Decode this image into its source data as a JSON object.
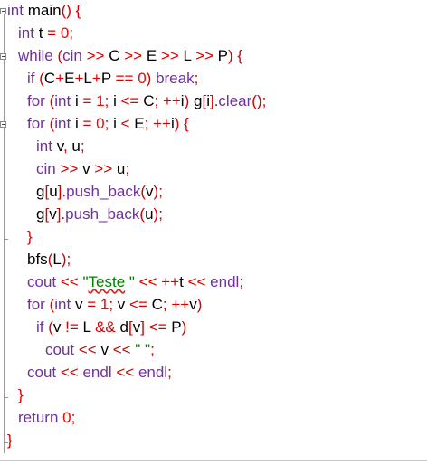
{
  "editor": {
    "lines": [
      "int main() {",
      "int t = 0;",
      "while (cin >> C >> E >> L >> P) {",
      "if (C+E+L+P == 0) break;",
      "for (int i = 1; i <= C; ++i) g[i].clear();",
      "for (int i = 0; i < E; ++i) {",
      "int v, u;",
      "cin >> v >> u;",
      "g[u].push_back(v);",
      "g[v].push_back(u);",
      "}",
      "bfs(L);",
      "cout << \"Teste \" << ++t << endl;",
      "for (int v = 1; v <= C; ++v)",
      "if (v != L && d[v] <= P)",
      "cout << v << \" \";",
      "cout << endl << endl;",
      "}",
      "return 0;",
      "}"
    ]
  }
}
